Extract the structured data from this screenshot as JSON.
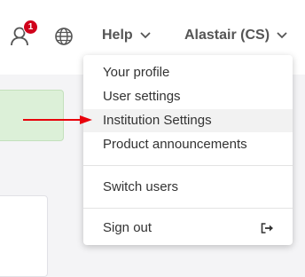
{
  "header": {
    "notification_count": "1",
    "help_label": "Help",
    "user_label": "Alastair (CS)"
  },
  "dropdown": {
    "items": [
      {
        "label": "Your profile"
      },
      {
        "label": "User settings"
      },
      {
        "label": "Institution Settings"
      },
      {
        "label": "Product announcements"
      },
      {
        "label": "Switch users"
      },
      {
        "label": "Sign out"
      }
    ]
  },
  "colors": {
    "badge": "#d0021b",
    "arrow": "#e8000b",
    "hover_row": "#f2f2f2"
  }
}
